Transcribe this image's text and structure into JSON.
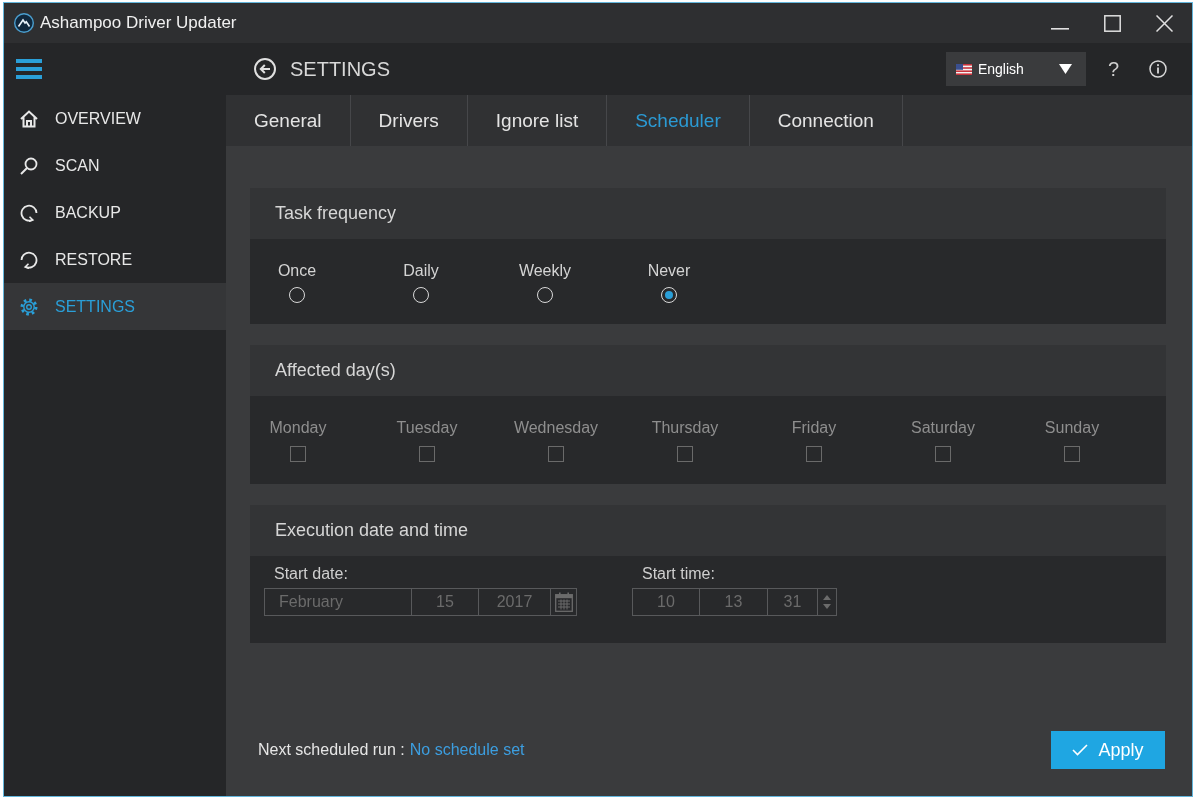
{
  "window": {
    "title": "Ashampoo Driver Updater"
  },
  "header": {
    "title": "SETTINGS",
    "language": "English",
    "help": "?"
  },
  "sidebar": {
    "items": [
      {
        "label": "OVERVIEW",
        "selected": false
      },
      {
        "label": "SCAN",
        "selected": false
      },
      {
        "label": "BACKUP",
        "selected": false
      },
      {
        "label": "RESTORE",
        "selected": false
      },
      {
        "label": "SETTINGS",
        "selected": true
      }
    ]
  },
  "tabs": [
    {
      "label": "General",
      "selected": false
    },
    {
      "label": "Drivers",
      "selected": false
    },
    {
      "label": "Ignore list",
      "selected": false
    },
    {
      "label": "Scheduler",
      "selected": true
    },
    {
      "label": "Connection",
      "selected": false
    }
  ],
  "task_frequency": {
    "title": "Task frequency",
    "options": [
      {
        "label": "Once",
        "selected": false
      },
      {
        "label": "Daily",
        "selected": false
      },
      {
        "label": "Weekly",
        "selected": false
      },
      {
        "label": "Never",
        "selected": true
      }
    ]
  },
  "affected_days": {
    "title": "Affected day(s)",
    "days": [
      {
        "label": "Monday",
        "checked": false,
        "disabled": true
      },
      {
        "label": "Tuesday",
        "checked": false,
        "disabled": true
      },
      {
        "label": "Wednesday",
        "checked": false,
        "disabled": true
      },
      {
        "label": "Thursday",
        "checked": false,
        "disabled": true
      },
      {
        "label": "Friday",
        "checked": false,
        "disabled": true
      },
      {
        "label": "Saturday",
        "checked": false,
        "disabled": true
      },
      {
        "label": "Sunday",
        "checked": false,
        "disabled": true
      }
    ]
  },
  "execution": {
    "title": "Execution date and time",
    "start_date": {
      "label": "Start date:",
      "month": "February",
      "day": "15",
      "year": "2017",
      "disabled": true
    },
    "start_time": {
      "label": "Start time:",
      "hour": "10",
      "minute": "13",
      "second": "31",
      "disabled": true
    }
  },
  "footer": {
    "next_run_label": "Next scheduled run :",
    "next_run_value": "No schedule set",
    "apply": "Apply"
  }
}
